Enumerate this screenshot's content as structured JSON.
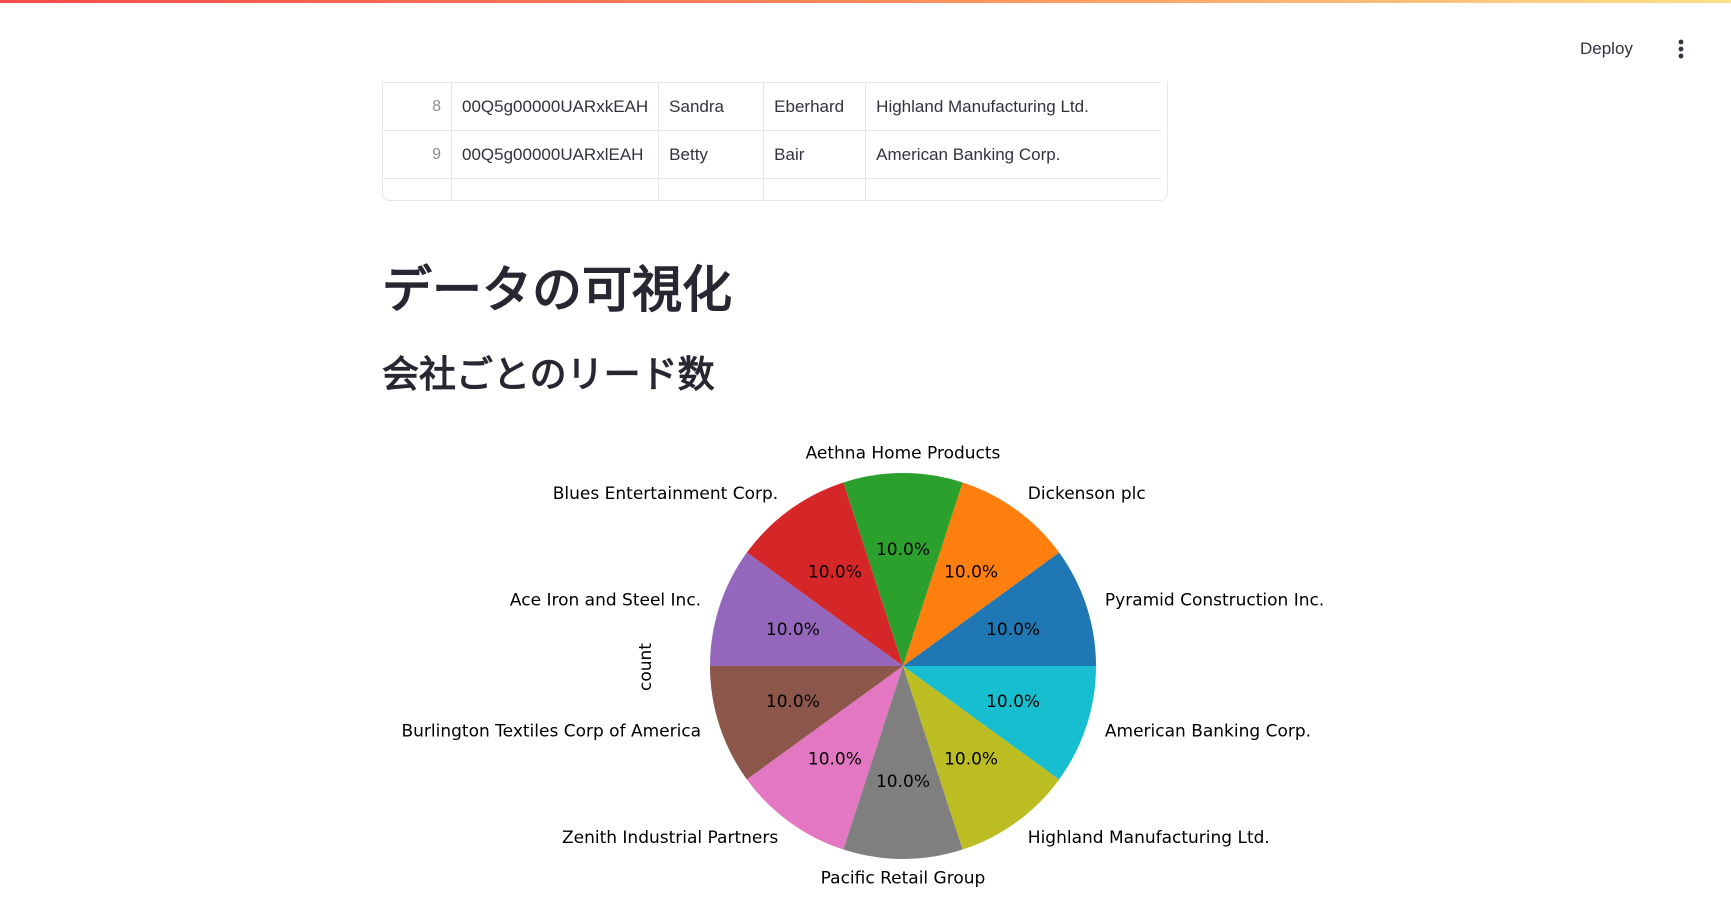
{
  "header": {
    "deploy_label": "Deploy",
    "menu_icon": "vertical-ellipsis-icon"
  },
  "table": {
    "rows": [
      {
        "index": "8",
        "id": "00Q5g00000UARxkEAH",
        "first_name": "Sandra",
        "last_name": "Eberhard",
        "company": "Highland Manufacturing Ltd."
      },
      {
        "index": "9",
        "id": "00Q5g00000UARxlEAH",
        "first_name": "Betty",
        "last_name": "Bair",
        "company": "American Banking Corp."
      }
    ]
  },
  "page": {
    "title": "データの可視化",
    "subtitle": "会社ごとのリード数"
  },
  "chart_data": {
    "type": "pie",
    "ylabel": "count",
    "slices": [
      {
        "label": "Pyramid Construction Inc.",
        "value": 1,
        "pct": "10.0%",
        "color": "#1f77b4"
      },
      {
        "label": "Dickenson plc",
        "value": 1,
        "pct": "10.0%",
        "color": "#ff7f0e"
      },
      {
        "label": "Aethna Home Products",
        "value": 1,
        "pct": "10.0%",
        "color": "#2ca02c"
      },
      {
        "label": "Blues Entertainment Corp.",
        "value": 1,
        "pct": "10.0%",
        "color": "#d62728"
      },
      {
        "label": "Ace Iron and Steel Inc.",
        "value": 1,
        "pct": "10.0%",
        "color": "#9467bd"
      },
      {
        "label": "Burlington Textiles Corp of America",
        "value": 1,
        "pct": "10.0%",
        "color": "#8c564b"
      },
      {
        "label": "Zenith Industrial Partners",
        "value": 1,
        "pct": "10.0%",
        "color": "#e377c2"
      },
      {
        "label": "Pacific Retail Group",
        "value": 1,
        "pct": "10.0%",
        "color": "#7f7f7f"
      },
      {
        "label": "Highland Manufacturing Ltd.",
        "value": 1,
        "pct": "10.0%",
        "color": "#bcbd22"
      },
      {
        "label": "American Banking Corp.",
        "value": 1,
        "pct": "10.0%",
        "color": "#17becf"
      }
    ]
  }
}
